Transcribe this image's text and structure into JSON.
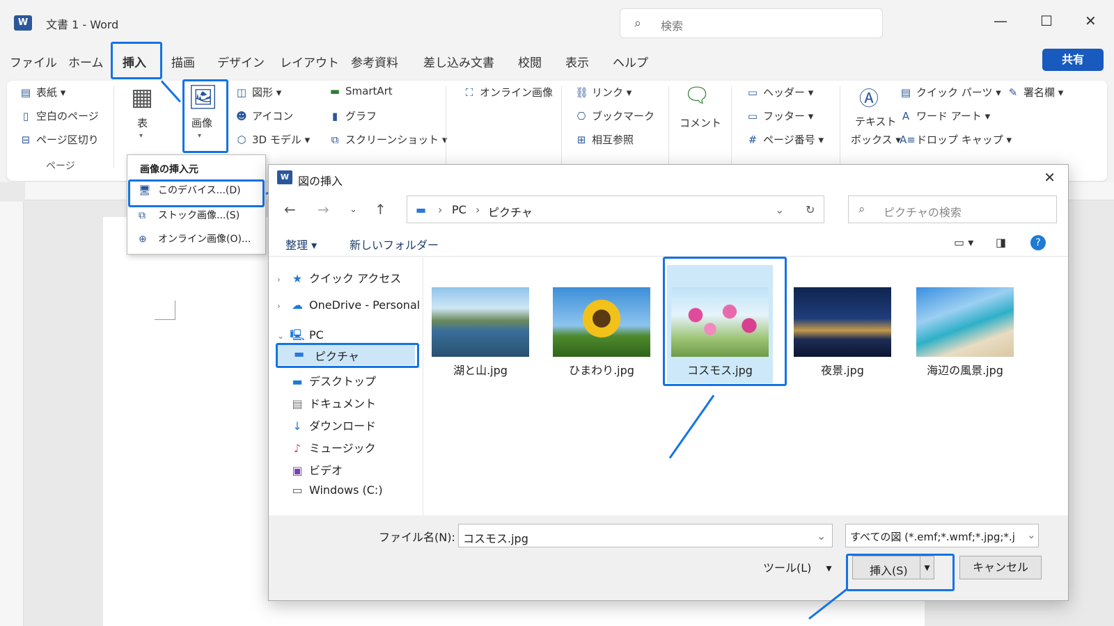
{
  "window": {
    "title": "文書 1  -  Word",
    "logo": "W"
  },
  "search": {
    "placeholder": "検索"
  },
  "window_controls": {
    "minimize": "—",
    "maximize": "☐",
    "close": "✕"
  },
  "menu": {
    "tabs": [
      "ファイル",
      "ホーム",
      "挿入",
      "描画",
      "デザイン",
      "レイアウト",
      "参考資料",
      "差し込み文書",
      "校閲",
      "表示",
      "ヘルプ"
    ],
    "active": "挿入",
    "share": "共有"
  },
  "ribbon": {
    "pages": {
      "cover": "表紙",
      "blank": "空白のページ",
      "break": "ページ区切り",
      "group": "ページ"
    },
    "table": "表",
    "image": "画像",
    "illustrations": {
      "shapes": "図形",
      "icons": "アイコン",
      "model3d": "3D モデル",
      "smartart": "SmartArt",
      "chart": "グラフ",
      "screenshot": "スクリーンショット"
    },
    "online_image": "オンライン画像",
    "links": {
      "link": "リンク",
      "bookmark": "ブックマーク",
      "crossref": "相互参照"
    },
    "comment": "コメント",
    "header_footer": {
      "header": "ヘッダー",
      "footer": "フッター",
      "page_number": "ページ番号"
    },
    "text": {
      "textbox_1": "テキスト",
      "textbox_2": "ボックス",
      "quickparts": "クイック パーツ",
      "wordart": "ワード アート",
      "dropcap": "ドロップ キャップ",
      "signature": "署名欄"
    }
  },
  "dropdown": {
    "header": "画像の挿入元",
    "items": [
      "このデバイス...(D)",
      "ストック画像...(S)",
      "オンライン画像(O)..."
    ]
  },
  "dialog": {
    "title": "図の挿入",
    "logo": "W",
    "address": {
      "root": "PC",
      "folder": "ピクチャ"
    },
    "search_placeholder": "ピクチャの検索",
    "organize": "整理",
    "new_folder": "新しいフォルダー",
    "nav": [
      "クイック アクセス",
      "OneDrive - Personal",
      "PC",
      "ピクチャ",
      "デスクトップ",
      "ドキュメント",
      "ダウンロード",
      "ミュージック",
      "ビデオ",
      "Windows (C:)"
    ],
    "files": [
      "湖と山.jpg",
      "ひまわり.jpg",
      "コスモス.jpg",
      "夜景.jpg",
      "海辺の風景.jpg"
    ],
    "selected_file": "コスモス.jpg",
    "filename_label": "ファイル名(N):",
    "filename_value": "コスモス.jpg",
    "filetype": "すべての図 (*.emf;*.wmf;*.jpg;*.j",
    "tools": "ツール(L)",
    "insert": "挿入(S)",
    "cancel": "キャンセル"
  },
  "accent_color": "#1473e6"
}
